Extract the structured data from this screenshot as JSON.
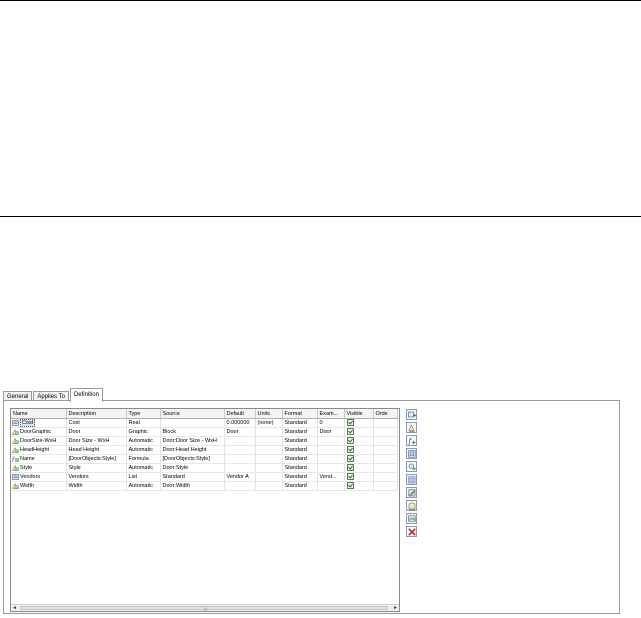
{
  "tabs": [
    {
      "label": "General",
      "active": false
    },
    {
      "label": "Applies To",
      "active": false
    },
    {
      "label": "Definition",
      "active": true
    }
  ],
  "grid": {
    "columns": [
      "Name",
      "Description",
      "Type",
      "Source",
      "Default",
      "Units",
      "Format",
      "Exam...",
      "Visible",
      "Orde"
    ],
    "rows": [
      {
        "icon": "list-property-icon",
        "name": "Cost",
        "description": "Cost",
        "type": "Real",
        "source": "",
        "default": "0.000000",
        "units": "(none)",
        "format": "Standard",
        "example": "0",
        "visible": true,
        "selected": true
      },
      {
        "icon": "automatic-property-icon",
        "name": "DoorGraphic",
        "description": "Door",
        "type": "Graphic",
        "source": "Block",
        "default": "Door",
        "units": "",
        "format": "Standard",
        "example": "Door",
        "visible": true,
        "selected": false
      },
      {
        "icon": "automatic-property-icon",
        "name": "DoorSize-WxH",
        "description": "Door Size - WxH",
        "type": "Automatic",
        "source": "Door:Door Size - WxH",
        "default": "",
        "units": "",
        "format": "Standard",
        "example": "",
        "visible": true,
        "selected": false
      },
      {
        "icon": "automatic-property-icon",
        "name": "HeadHeight",
        "description": "Head Height",
        "type": "Automatic",
        "source": "Door:Head Height",
        "default": "",
        "units": "",
        "format": "Standard",
        "example": "",
        "visible": true,
        "selected": false
      },
      {
        "icon": "formula-property-icon",
        "name": "Name",
        "description": "[DoorObjects:Style]",
        "type": "Formula",
        "source": "[DoorObjects:Style]",
        "default": "",
        "units": "",
        "format": "Standard",
        "example": "",
        "visible": true,
        "selected": false
      },
      {
        "icon": "automatic-property-icon",
        "name": "Style",
        "description": "Style",
        "type": "Automatic",
        "source": "Door:Style",
        "default": "",
        "units": "",
        "format": "Standard",
        "example": "",
        "visible": true,
        "selected": false
      },
      {
        "icon": "list-property-icon",
        "name": "Vendors",
        "description": "Vendors",
        "type": "List",
        "source": "Standard",
        "default": "Vendor A",
        "units": "",
        "format": "Standard",
        "example": "Vend...",
        "visible": true,
        "selected": false
      },
      {
        "icon": "automatic-property-icon",
        "name": "Width",
        "description": "Width",
        "type": "Automatic",
        "source": "Door:Width",
        "default": "",
        "units": "",
        "format": "Standard",
        "example": "",
        "visible": true,
        "selected": false
      }
    ]
  },
  "scrollbar": {
    "left_arrow": "◄",
    "right_arrow": "►",
    "grip": "|||"
  },
  "toolbar": [
    {
      "icon": "add-manual-property-icon"
    },
    {
      "icon": "add-automatic-property-icon"
    },
    {
      "icon": "add-formula-property-icon"
    },
    {
      "icon": "add-anchor-property-icon"
    },
    {
      "icon": "add-location-property-icon"
    },
    {
      "icon": "add-classification-property-icon"
    },
    {
      "icon": "add-material-property-icon"
    },
    {
      "icon": "add-project-property-icon"
    },
    {
      "icon": "add-graphic-property-icon"
    },
    {
      "icon": "remove-property-icon"
    }
  ]
}
